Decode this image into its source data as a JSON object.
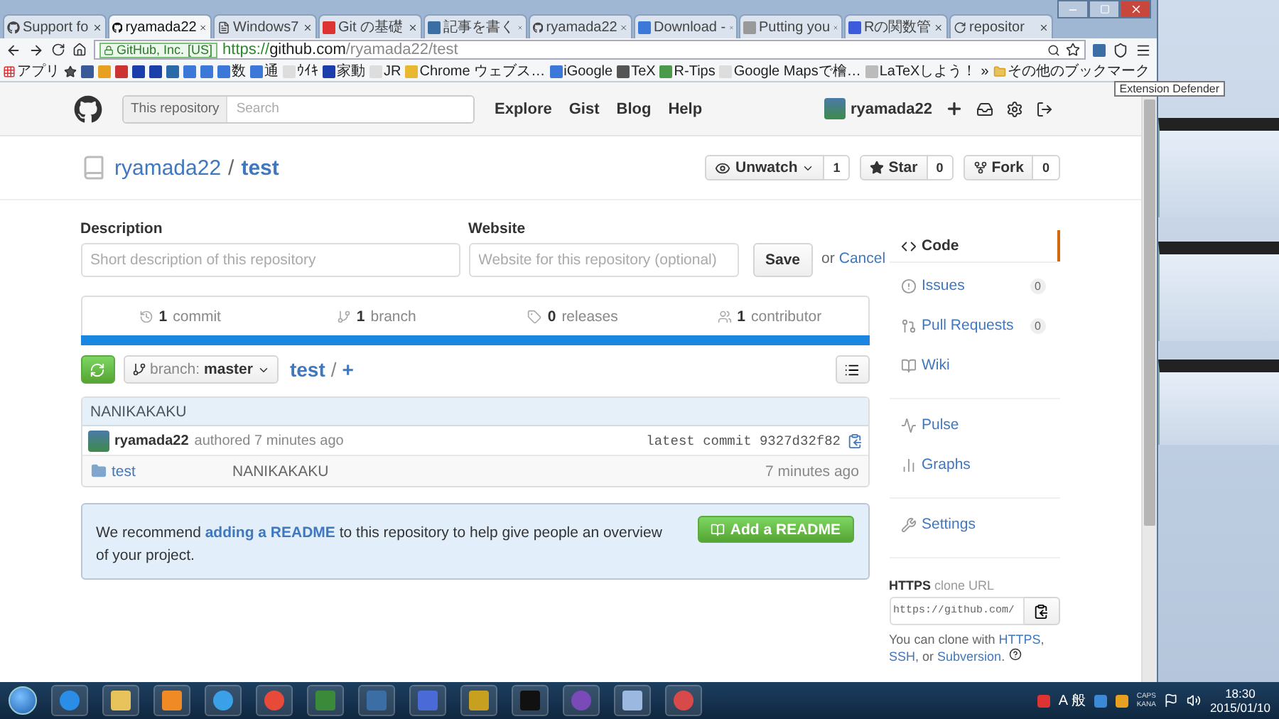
{
  "browser": {
    "tabs": [
      {
        "title": "Support fo",
        "kind": "github",
        "selected": false
      },
      {
        "title": "ryamada22",
        "kind": "github",
        "selected": true
      },
      {
        "title": "Windows7",
        "kind": "page",
        "selected": false
      },
      {
        "title": "Git の基礎",
        "kind": "gear",
        "selected": false
      },
      {
        "title": "記事を書く",
        "kind": "blog",
        "selected": false
      },
      {
        "title": "ryamada22",
        "kind": "github",
        "selected": false
      },
      {
        "title": "Download -",
        "kind": "home",
        "selected": false
      },
      {
        "title": "Putting you",
        "kind": "person",
        "selected": false
      },
      {
        "title": "Rの関数管",
        "kind": "doc",
        "selected": false
      },
      {
        "title": "repositor",
        "kind": "loading",
        "selected": false
      }
    ],
    "address": {
      "badge": "GitHub, Inc. [US]",
      "scheme": "https://",
      "host": "github.com",
      "path": "/ryamada22/test"
    },
    "bookmarks_left": [
      {
        "label": "アプリ"
      }
    ],
    "bookmarks": [
      {
        "label": "数",
        "color": "#3b78d8"
      },
      {
        "label": "通",
        "color": "#3b78d8"
      },
      {
        "label": "ｳｲｷ",
        "color": "#dddddd"
      },
      {
        "label": "家動",
        "color": "#1a3faa"
      },
      {
        "label": "JR",
        "color": "#dddddd"
      },
      {
        "label": "Chrome ウェブス…",
        "color": "#e8b830"
      },
      {
        "label": "iGoogle",
        "color": "#3b78d8"
      },
      {
        "label": "TeX",
        "color": "#555555"
      },
      {
        "label": "R-Tips",
        "color": "#4a9a4a"
      },
      {
        "label": "Google Mapsで檜…",
        "color": "#dddddd"
      },
      {
        "label": "LaTeXしよう！",
        "color": "#bbbbbb"
      }
    ],
    "more": "»",
    "other_bookmarks": "その他のブックマーク",
    "tooltip": "Extension Defender"
  },
  "header": {
    "search_scope": "This repository",
    "search_placeholder": "Search",
    "nav": [
      "Explore",
      "Gist",
      "Blog",
      "Help"
    ],
    "username": "ryamada22"
  },
  "repo": {
    "owner": "ryamada22",
    "separator": "/",
    "name": "test",
    "actions": [
      {
        "kind": "watch",
        "label": "Unwatch",
        "count": "1"
      },
      {
        "kind": "star",
        "label": "Star",
        "count": "0"
      },
      {
        "kind": "fork",
        "label": "Fork",
        "count": "0"
      }
    ]
  },
  "edit": {
    "description_label": "Description",
    "description_placeholder": "Short description of this repository",
    "website_label": "Website",
    "website_placeholder": "Website for this repository (optional)",
    "save": "Save",
    "or": "or",
    "cancel": "Cancel"
  },
  "stats": [
    {
      "kind": "commit",
      "count": "1",
      "label": "commit"
    },
    {
      "kind": "branch",
      "count": "1",
      "label": "branch"
    },
    {
      "kind": "release",
      "count": "0",
      "label": "releases"
    },
    {
      "kind": "contributor",
      "count": "1",
      "label": "contributor"
    }
  ],
  "file_nav": {
    "branch_prefix": "branch:",
    "branch": "master",
    "path": "test",
    "separator": "/",
    "add": "+"
  },
  "commit": {
    "message": "NANIKAKAKU",
    "author": "ryamada22",
    "meta": "authored 7 minutes ago",
    "latest_label": "latest commit",
    "sha": "9327d32f82"
  },
  "files": [
    {
      "name": "test",
      "message": "NANIKAKAKU",
      "age": "7 minutes ago"
    }
  ],
  "readme_notice": {
    "before": "We recommend ",
    "link": "adding a README",
    "after": " to this repository to help give people an overview of your project.",
    "button": "Add a README"
  },
  "sidebar": {
    "groups": [
      {
        "items": [
          {
            "kind": "code",
            "label": "Code",
            "selected": true
          },
          {
            "kind": "issues",
            "label": "Issues",
            "count": "0",
            "selected": false
          },
          {
            "kind": "pulls",
            "label": "Pull Requests",
            "count": "0",
            "selected": false
          },
          {
            "kind": "wiki",
            "label": "Wiki",
            "selected": false
          }
        ]
      },
      {
        "items": [
          {
            "kind": "pulse",
            "label": "Pulse",
            "selected": false
          },
          {
            "kind": "graphs",
            "label": "Graphs",
            "selected": false
          }
        ]
      },
      {
        "items": [
          {
            "kind": "settings",
            "label": "Settings",
            "selected": false
          }
        ]
      }
    ]
  },
  "clone": {
    "protocol": "HTTPS",
    "label": "clone URL",
    "value": "https://github.com/",
    "help": [
      {
        "text": "You can clone with ",
        "kind": "text"
      },
      {
        "text": "HTTPS",
        "kind": "link"
      },
      {
        "text": ", ",
        "kind": "text"
      },
      {
        "text": "SSH",
        "kind": "link"
      },
      {
        "text": ", or ",
        "kind": "text"
      },
      {
        "text": "Subversion",
        "kind": "link"
      },
      {
        "text": ".",
        "kind": "text"
      }
    ]
  },
  "taskbar": {
    "apps": [
      {
        "kind": "ie"
      },
      {
        "kind": "folder"
      },
      {
        "kind": "media"
      },
      {
        "kind": "wifi"
      },
      {
        "kind": "chrome"
      },
      {
        "kind": "game"
      },
      {
        "kind": "python"
      },
      {
        "kind": "r"
      },
      {
        "kind": "kanji"
      },
      {
        "kind": "terminal"
      },
      {
        "kind": "cat"
      },
      {
        "kind": "paint"
      },
      {
        "kind": "tool"
      }
    ],
    "ime": "A 般",
    "caps": "CAPS",
    "kana": "KANA",
    "time": "18:30",
    "date": "2015/01/10"
  }
}
